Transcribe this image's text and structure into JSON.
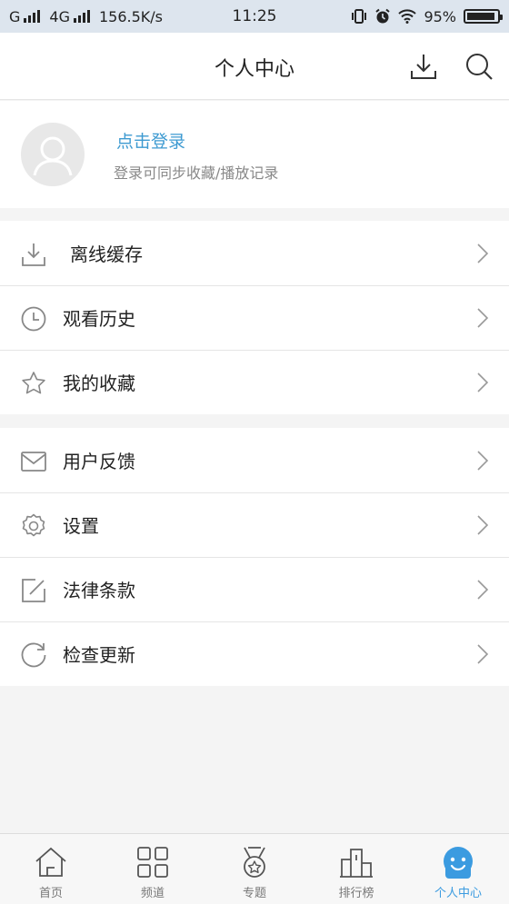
{
  "status_bar": {
    "carrier": "G",
    "network": "4G",
    "speed": "156.5K/s",
    "time": "11:25",
    "battery": "95%",
    "battery_level": 0.95
  },
  "header": {
    "title": "个人中心",
    "download_icon": "download-icon",
    "search_icon": "search-icon"
  },
  "profile": {
    "login_label": "点击登录",
    "login_hint": "登录可同步收藏/播放记录",
    "avatar_icon": "user-avatar-icon"
  },
  "menu_group_1": [
    {
      "label": "离线缓存",
      "icon": "download-icon"
    },
    {
      "label": "观看历史",
      "icon": "clock-icon"
    },
    {
      "label": "我的收藏",
      "icon": "star-icon"
    }
  ],
  "menu_group_2": [
    {
      "label": "用户反馈",
      "icon": "mail-icon"
    },
    {
      "label": "设置",
      "icon": "gear-icon"
    },
    {
      "label": "法律条款",
      "icon": "edit-icon"
    },
    {
      "label": "检查更新",
      "icon": "refresh-icon"
    }
  ],
  "tabbar": {
    "active": "个人中心",
    "accent_color": "#3b9be0",
    "items": [
      {
        "label": "首页",
        "icon": "home-icon"
      },
      {
        "label": "频道",
        "icon": "grid-icon"
      },
      {
        "label": "专题",
        "icon": "medal-icon"
      },
      {
        "label": "排行榜",
        "icon": "ranking-icon"
      },
      {
        "label": "个人中心",
        "icon": "profile-face-icon"
      }
    ]
  }
}
